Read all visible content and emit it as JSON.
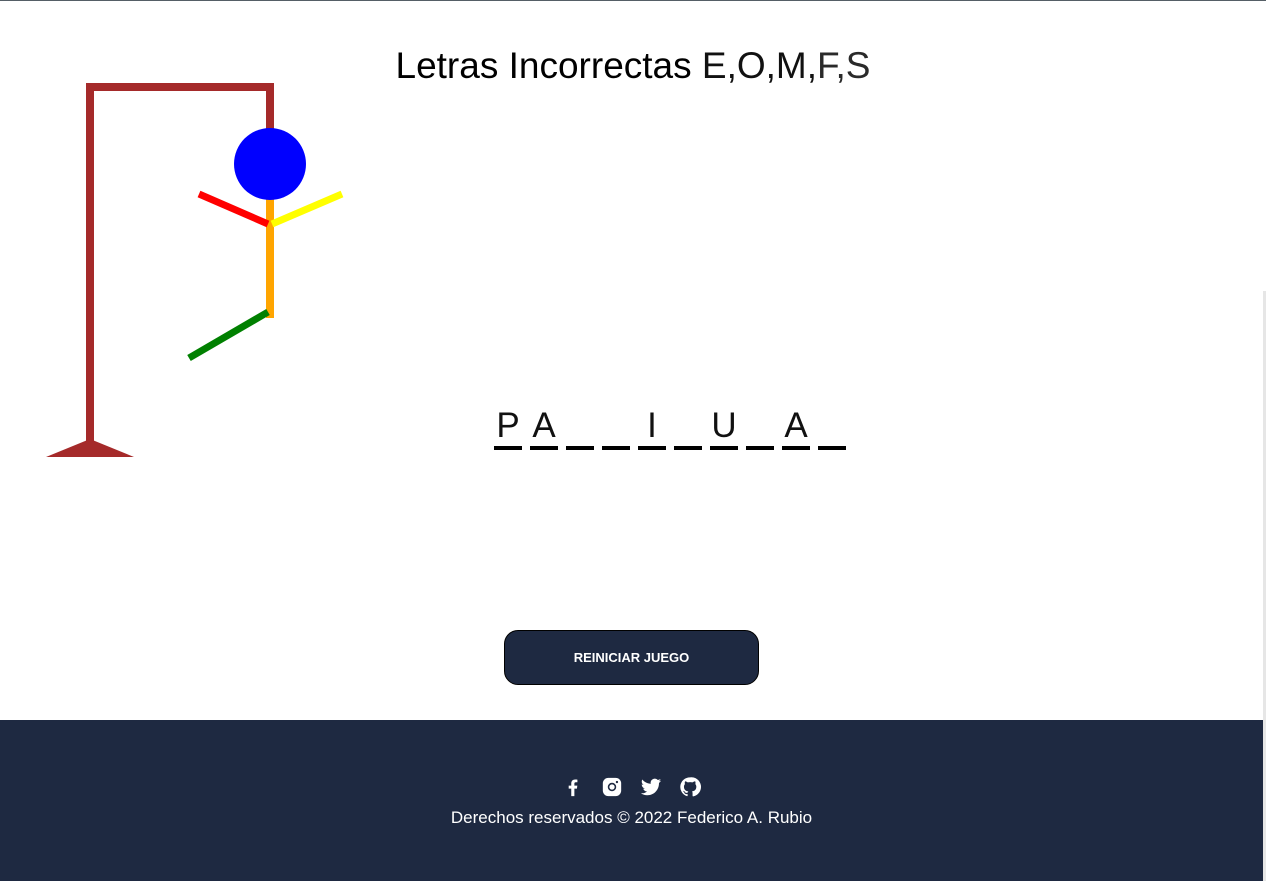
{
  "header": {
    "title_prefix": "Letras Incorrectas ",
    "wrong_letters_dark": "E,O,M,",
    "wrong_letters_light": "F,S"
  },
  "word": {
    "slots": [
      "P",
      "A",
      "",
      "",
      "I",
      "",
      "U",
      "",
      "A",
      ""
    ]
  },
  "actions": {
    "restart_label": "REINICIAR JUEGO"
  },
  "footer": {
    "social_icons": [
      "facebook-icon",
      "instagram-icon",
      "twitter-icon",
      "github-icon"
    ],
    "copyright": "Derechos reservados © 2022 Federico A. Rubio"
  },
  "colors": {
    "gallows": "#a52a2a",
    "head": "#0000ff",
    "body": "#ffa500",
    "left_arm": "#ff0000",
    "right_arm": "#ffff00",
    "left_leg": "#008000",
    "footer_bg": "#1e2941",
    "button_bg": "#1e2941"
  }
}
